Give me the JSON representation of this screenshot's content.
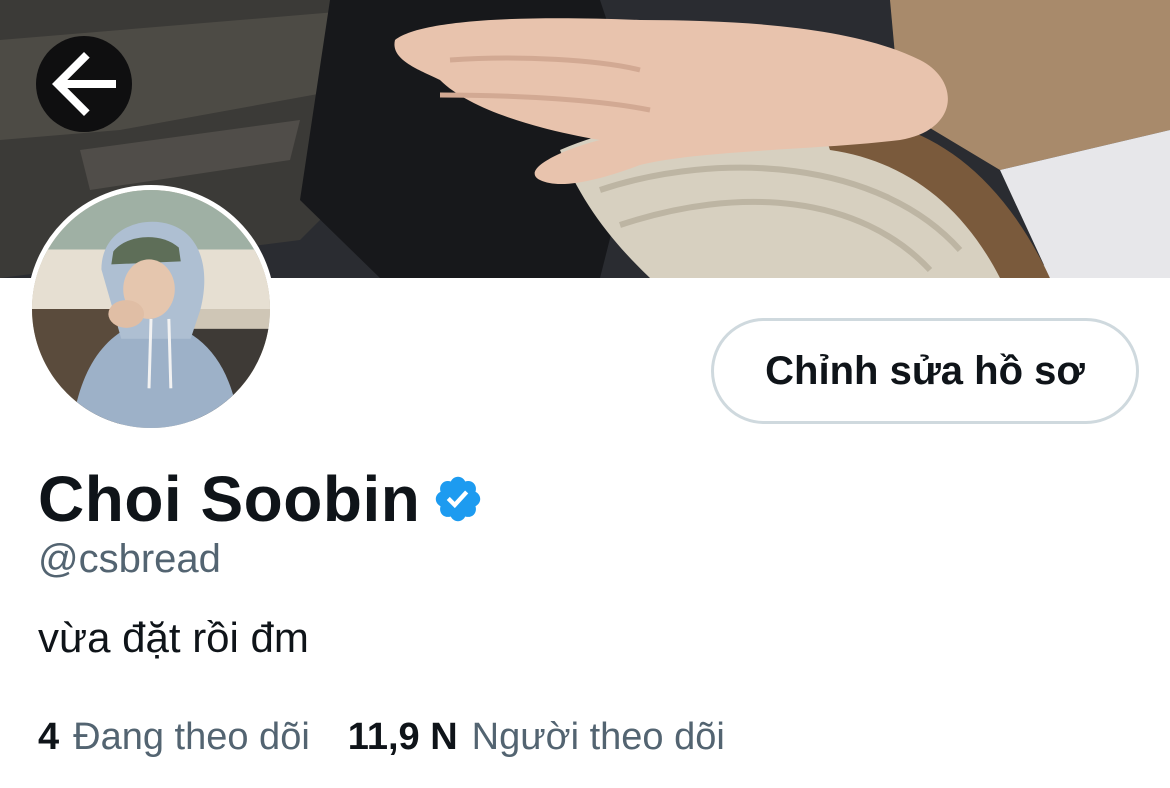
{
  "profile": {
    "display_name": "Choi Soobin",
    "handle": "@csbread",
    "bio": "vừa đặt rồi đm",
    "verified": true
  },
  "actions": {
    "edit_profile_label": "Chỉnh sửa hồ sơ"
  },
  "stats": {
    "following_count": "4",
    "following_label": "Đang theo dõi",
    "followers_count": "11,9 N",
    "followers_label": "Người theo dõi"
  },
  "icons": {
    "back": "back-arrow-icon",
    "verified": "verified-badge-icon"
  },
  "colors": {
    "verified_blue": "#1d9bf0",
    "text_primary": "#0f1419",
    "text_secondary": "#536471",
    "button_border": "#cfd9de"
  }
}
